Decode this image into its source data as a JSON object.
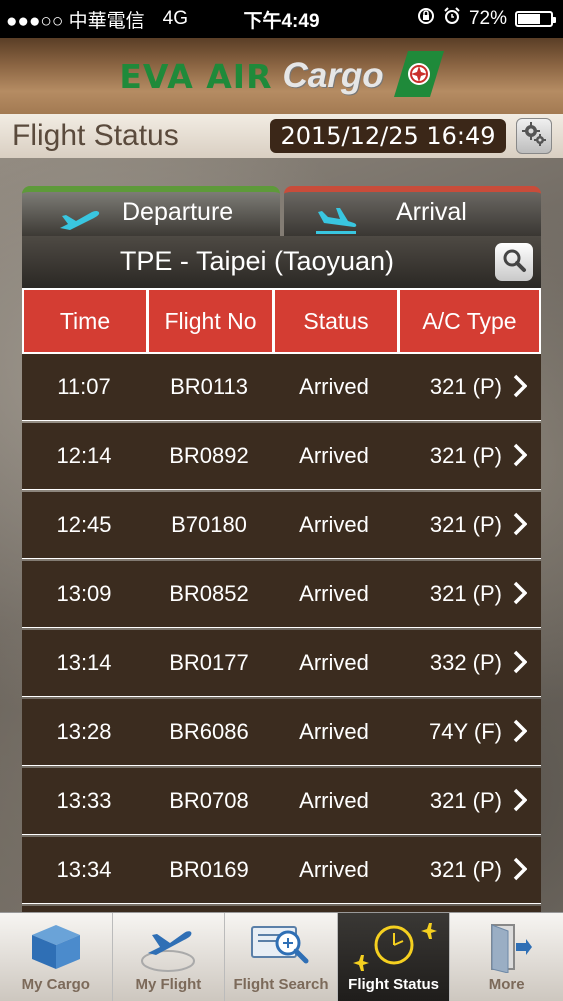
{
  "status_bar": {
    "carrier": "●●●○○ 中華電信",
    "network": "4G",
    "time": "下午4:49",
    "battery": "72%",
    "battery_level": 0.72
  },
  "header": {
    "logo_text_1": "EVA AIR",
    "logo_text_2": "Cargo"
  },
  "titlebar": {
    "title": "Flight Status",
    "datetime": "2015/12/25 16:49",
    "settings_icon": "gear-icon"
  },
  "tabs": {
    "departure": "Departure",
    "arrival": "Arrival",
    "active": "arrival"
  },
  "airport": {
    "name": "TPE - Taipei (Taoyuan)"
  },
  "table": {
    "columns": [
      "Time",
      "Flight No",
      "Status",
      "A/C Type"
    ],
    "rows": [
      {
        "time": "11:07",
        "flight": "BR0113",
        "status": "Arrived",
        "ac": "321 (P)"
      },
      {
        "time": "12:14",
        "flight": "BR0892",
        "status": "Arrived",
        "ac": "321 (P)"
      },
      {
        "time": "12:45",
        "flight": "B70180",
        "status": "Arrived",
        "ac": "321 (P)"
      },
      {
        "time": "13:09",
        "flight": "BR0852",
        "status": "Arrived",
        "ac": "321 (P)"
      },
      {
        "time": "13:14",
        "flight": "BR0177",
        "status": "Arrived",
        "ac": "332 (P)"
      },
      {
        "time": "13:28",
        "flight": "BR6086",
        "status": "Arrived",
        "ac": "74Y (F)"
      },
      {
        "time": "13:33",
        "flight": "BR0708",
        "status": "Arrived",
        "ac": "321 (P)"
      },
      {
        "time": "13:34",
        "flight": "BR0169",
        "status": "Arrived",
        "ac": "321 (P)"
      }
    ]
  },
  "tabbar": {
    "items": [
      {
        "label": "My Cargo",
        "icon": "box-icon"
      },
      {
        "label": "My Flight",
        "icon": "plane-globe-icon"
      },
      {
        "label": "Flight Search",
        "icon": "magnifier-screen-icon"
      },
      {
        "label": "Flight Status",
        "icon": "clock-plane-icon"
      },
      {
        "label": "More",
        "icon": "door-exit-icon"
      }
    ],
    "active_index": 3
  },
  "colors": {
    "header_red": "#d43d33",
    "row_brown": "#3b2c1f",
    "eva_green": "#1f8a3a",
    "departure_green": "#5e9a3a",
    "arrival_red": "#c94c3a",
    "plane_cyan": "#39c6e0"
  }
}
